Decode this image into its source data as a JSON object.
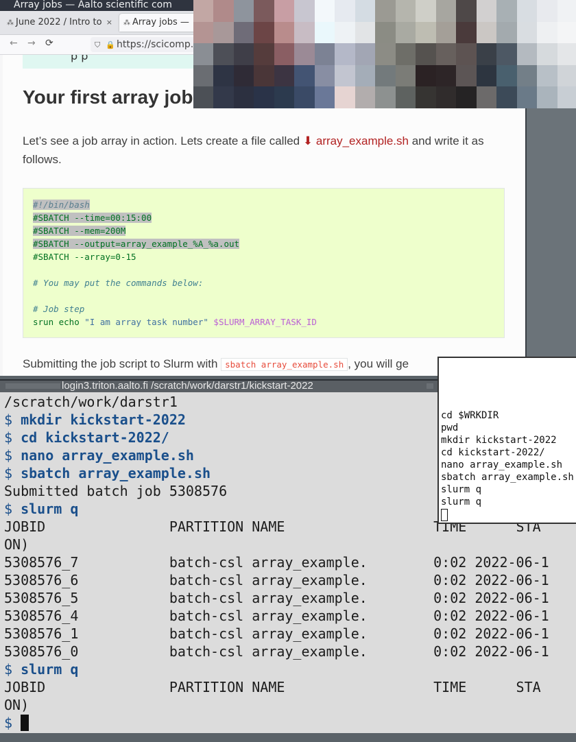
{
  "browser": {
    "window_title": "Array jobs — Aalto scientific com",
    "tabs": [
      {
        "label": "June 2022 / Intro to",
        "close": "×"
      },
      {
        "label": "Array jobs —",
        "close": ""
      }
    ],
    "url": "https://scicomp.",
    "nav_icons": {
      "back": "←",
      "forward": "→",
      "reload": "⟳"
    }
  },
  "doc": {
    "note_fragment": "p      p",
    "heading": "Your first array job",
    "intro_before": "Let’s see a job array in action. Lets create a file called ",
    "intro_link": "array_example.sh",
    "intro_after": " and write it as follows.",
    "code_lines": [
      "#!/bin/bash",
      "#SBATCH --time=00:15:00",
      "#SBATCH --mem=200M",
      "#SBATCH --output=array_example_%A_%a.out",
      "#SBATCH --array=0-15",
      "",
      "# You may put the commands below:",
      "",
      "# Job step",
      "srun echo ",
      "\"I am array task number\"",
      "$SLURM_ARRAY_TASK_ID"
    ],
    "submit_before": "Submitting the job script to Slurm with ",
    "submit_code": "sbatch array_example.sh",
    "submit_after": ", you will ge"
  },
  "terminal": {
    "title": "login3.triton.aalto.fi   /scratch/work/darstr1/kickstart-2022",
    "prompt": "$",
    "lines": {
      "cwd": "/scratch/work/darstr1",
      "cmd1": "mkdir kickstart-2022",
      "cmd2": "cd kickstart-2022/",
      "cmd3": "nano array_example.sh",
      "cmd4": "sbatch array_example.sh",
      "submitted": "Submitted batch job 5308576",
      "cmd5": "slurm q",
      "header": "JOBID               PARTITION NAME                  TIME      STA",
      "header_wrap": "ON)",
      "rows": [
        "5308576_7           batch-csl array_example.        0:02 2022-06-1",
        "5308576_6           batch-csl array_example.        0:02 2022-06-1",
        "5308576_5           batch-csl array_example.        0:02 2022-06-1",
        "5308576_4           batch-csl array_example.        0:02 2022-06-1",
        "5308576_1           batch-csl array_example.        0:02 2022-06-1",
        "5308576_0           batch-csl array_example.        0:02 2022-06-1"
      ],
      "cmd6": "slurm q"
    }
  },
  "history": {
    "lines": [
      "cd $WRKDIR",
      "pwd",
      "mkdir kickstart-2022",
      "cd kickstart-2022/",
      "nano array_example.sh",
      "sbatch array_example.sh",
      "slurm q",
      "slurm q"
    ]
  },
  "colors": {
    "mosaic": [
      "#c2a7a4",
      "#b08a8a",
      "#8e949d",
      "#7b5a5c",
      "#c89ea4",
      "#c8c6d0",
      "#f3f8fb",
      "#e6eaf0",
      "#d4dce3",
      "#9b9a93",
      "#b5b5ad",
      "#cfcfc8",
      "#a7a6a0",
      "#4e4848",
      "#d2d0d0",
      "#a8b0b4",
      "#d8dde2",
      "#e8eaee",
      "#f0f2f4",
      "#b49493",
      "#a89899",
      "#6f6c78",
      "#6c4546",
      "#b98c8c",
      "#c8bcc4",
      "#eaf8fc",
      "#eef2f5",
      "#e2e4e6",
      "#8b8c84",
      "#a9aaa2",
      "#bebdb2",
      "#a49f98",
      "#4a3a3b",
      "#cbc7c4",
      "#a3aaae",
      "#d9dde1",
      "#eef0f2",
      "#f4f5f6",
      "#8a8e94",
      "#4d4f57",
      "#3f3e48",
      "#553c3c",
      "#8a5e63",
      "#9b8a96",
      "#7c8294",
      "#b4b8c8",
      "#a2a6b4",
      "#8c8c85",
      "#6e6e68",
      "#55524f",
      "#67605d",
      "#5d5352",
      "#3a4048",
      "#4d5864",
      "#b4bac0",
      "#d6dadd",
      "#e4e6e8",
      "#6a6d72",
      "#2e3444",
      "#2f2b36",
      "#4a3638",
      "#3c3442",
      "#435473",
      "#888ea3",
      "#c2c5d0",
      "#a4adb8",
      "#737a7c",
      "#7b7c77",
      "#2b2224",
      "#2d2527",
      "#5c5555",
      "#2d3540",
      "#49606e",
      "#737f88",
      "#b8c0c7",
      "#d0d4d8",
      "#4c5056",
      "#33394a",
      "#2c3040",
      "#2a3348",
      "#2c3a4e",
      "#3a4a66",
      "#6a7898",
      "#e6d4d2",
      "#b2adad",
      "#8d9190",
      "#5e6260",
      "#363432",
      "#302c2c",
      "#252324",
      "#6c6a6a",
      "#3c4a58",
      "#6a7a88",
      "#aab4bc",
      "#c8ced4"
    ]
  }
}
